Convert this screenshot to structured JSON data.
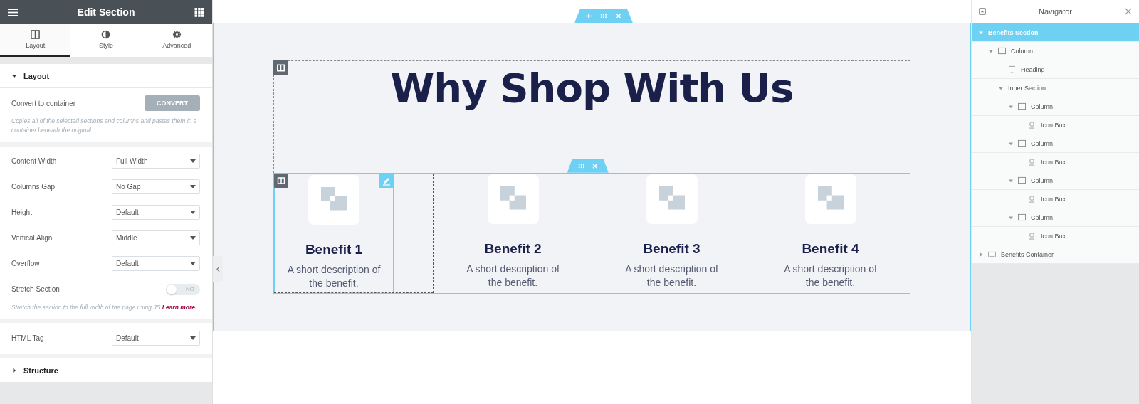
{
  "panel": {
    "title": "Edit Section",
    "tabs": [
      {
        "label": "Layout",
        "selected": true
      },
      {
        "label": "Style",
        "selected": false
      },
      {
        "label": "Advanced",
        "selected": false
      }
    ],
    "sections": [
      {
        "title": "Layout",
        "expanded": true,
        "groups": [
          [
            {
              "kind": "button",
              "label": "Convert to container",
              "value": "CONVERT"
            },
            {
              "kind": "note",
              "text": "Copies all of the selected sections and columns and pastes them in a container beneath the original."
            }
          ],
          [
            {
              "kind": "select",
              "label": "Content Width",
              "value": "Full Width"
            },
            {
              "kind": "select",
              "label": "Columns Gap",
              "value": "No Gap"
            },
            {
              "kind": "select",
              "label": "Height",
              "value": "Default"
            },
            {
              "kind": "select",
              "label": "Vertical Align",
              "value": "Middle"
            },
            {
              "kind": "select",
              "label": "Overflow",
              "value": "Default"
            },
            {
              "kind": "switch",
              "label": "Stretch Section",
              "on": false,
              "value": "NO"
            },
            {
              "kind": "note",
              "text": "Stretch the section to the full width of the page using JS.",
              "link": "Learn more."
            }
          ],
          [
            {
              "kind": "select",
              "label": "HTML Tag",
              "value": "Default"
            }
          ]
        ]
      },
      {
        "title": "Structure",
        "expanded": false
      }
    ]
  },
  "canvas": {
    "heading": "Why Shop With Us",
    "benefits": [
      {
        "title": "Benefit 1",
        "text": "A short description of the benefit.",
        "selected": true
      },
      {
        "title": "Benefit 2",
        "text": "A short description of the benefit.",
        "selected": false
      },
      {
        "title": "Benefit 3",
        "text": "A short description of the benefit.",
        "selected": false
      },
      {
        "title": "Benefit 4",
        "text": "A short description of the benefit.",
        "selected": false
      }
    ]
  },
  "navigator": {
    "title": "Navigator",
    "items": [
      {
        "label": "Benefits Section",
        "kind": "section",
        "selected": true,
        "expanded": true,
        "children": [
          {
            "label": "Column",
            "kind": "column",
            "selected": false,
            "expanded": true,
            "children": [
              {
                "label": "Heading",
                "kind": "heading",
                "selected": false
              },
              {
                "label": "Inner Section",
                "kind": "section",
                "selected": false,
                "expanded": true,
                "children": [
                  {
                    "label": "Column",
                    "kind": "column",
                    "selected": false,
                    "expanded": true,
                    "children": [
                      {
                        "label": "Icon Box",
                        "kind": "icon-box",
                        "selected": false
                      }
                    ]
                  },
                  {
                    "label": "Column",
                    "kind": "column",
                    "selected": false,
                    "expanded": true,
                    "children": [
                      {
                        "label": "Icon Box",
                        "kind": "icon-box",
                        "selected": false
                      }
                    ]
                  },
                  {
                    "label": "Column",
                    "kind": "column",
                    "selected": false,
                    "expanded": true,
                    "children": [
                      {
                        "label": "Icon Box",
                        "kind": "icon-box",
                        "selected": false
                      }
                    ]
                  },
                  {
                    "label": "Column",
                    "kind": "column",
                    "selected": false,
                    "expanded": true,
                    "children": [
                      {
                        "label": "Icon Box",
                        "kind": "icon-box",
                        "selected": false
                      }
                    ]
                  }
                ]
              }
            ]
          }
        ]
      },
      {
        "label": "Benefits Container",
        "kind": "container",
        "selected": false,
        "expanded": false
      }
    ]
  }
}
